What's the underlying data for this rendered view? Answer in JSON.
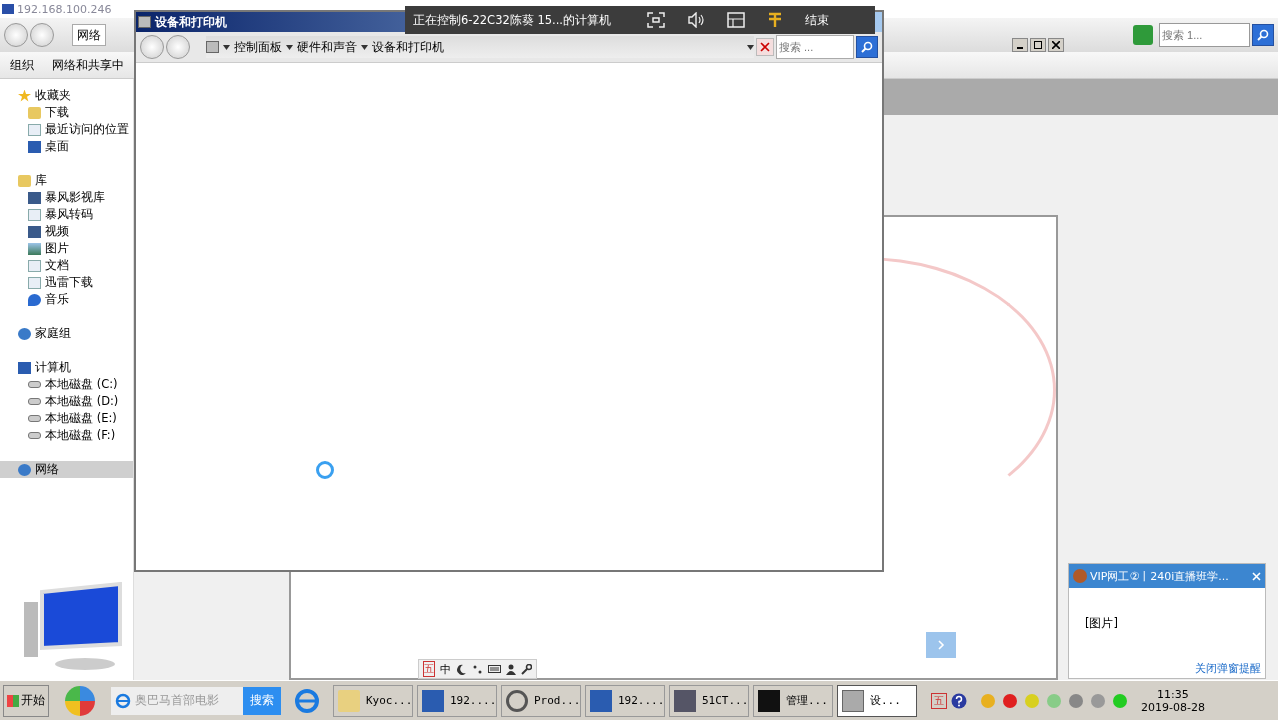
{
  "remote_title": "192.168.100.246",
  "explorer": {
    "address": "网络",
    "search_placeholder": "搜索 1...",
    "toolbar": [
      "组织",
      "网络和共享中"
    ],
    "sidebar": [
      {
        "label": "收藏夹",
        "selected": false,
        "children": [
          {
            "label": "下载",
            "selected": false
          },
          {
            "label": "最近访问的位置",
            "selected": false
          },
          {
            "label": "桌面",
            "selected": false
          }
        ]
      },
      {
        "label": "库",
        "selected": false,
        "children": [
          {
            "label": "暴风影视库",
            "selected": false
          },
          {
            "label": "暴风转码",
            "selected": false
          },
          {
            "label": "视频",
            "selected": false
          },
          {
            "label": "图片",
            "selected": false
          },
          {
            "label": "文档",
            "selected": false
          },
          {
            "label": "迅雷下载",
            "selected": false
          },
          {
            "label": "音乐",
            "selected": false
          }
        ]
      },
      {
        "label": "家庭组",
        "selected": false
      },
      {
        "label": "计算机",
        "selected": false,
        "children": [
          {
            "label": "本地磁盘 (C:)",
            "selected": false
          },
          {
            "label": "本地磁盘 (D:)",
            "selected": false
          },
          {
            "label": "本地磁盘 (E:)",
            "selected": false
          },
          {
            "label": "本地磁盘 (F:)",
            "selected": false
          }
        ]
      },
      {
        "label": "网络",
        "selected": true
      }
    ]
  },
  "devices_window": {
    "title": "设备和打印机",
    "breadcrumb": [
      "控制面板",
      "硬件和声音",
      "设备和打印机"
    ],
    "search_placeholder": "搜索 ..."
  },
  "remote_bar": {
    "status": "正在控制6-22C32陈葵 15...的计算机",
    "end": "结束"
  },
  "notification": {
    "title": "VIP网工②丨240i直播班学...",
    "body": "[图片]",
    "link": "关闭弹窗提醒"
  },
  "ime_bar": [
    "五",
    "中"
  ],
  "taskbar": {
    "start": "开始",
    "search_placeholder": "奥巴马首部电影",
    "search_button": "搜索",
    "tasks": [
      {
        "label": "Kyoc...",
        "selected": false
      },
      {
        "label": "192....",
        "selected": false
      },
      {
        "label": "Prod...",
        "selected": false
      },
      {
        "label": "192....",
        "selected": false
      },
      {
        "label": "51CT...",
        "selected": false
      },
      {
        "label": "管理...",
        "selected": false
      },
      {
        "label": "设...",
        "selected": true
      }
    ],
    "tray_ime": "五",
    "time": "11:35",
    "date": "2019-08-28"
  }
}
